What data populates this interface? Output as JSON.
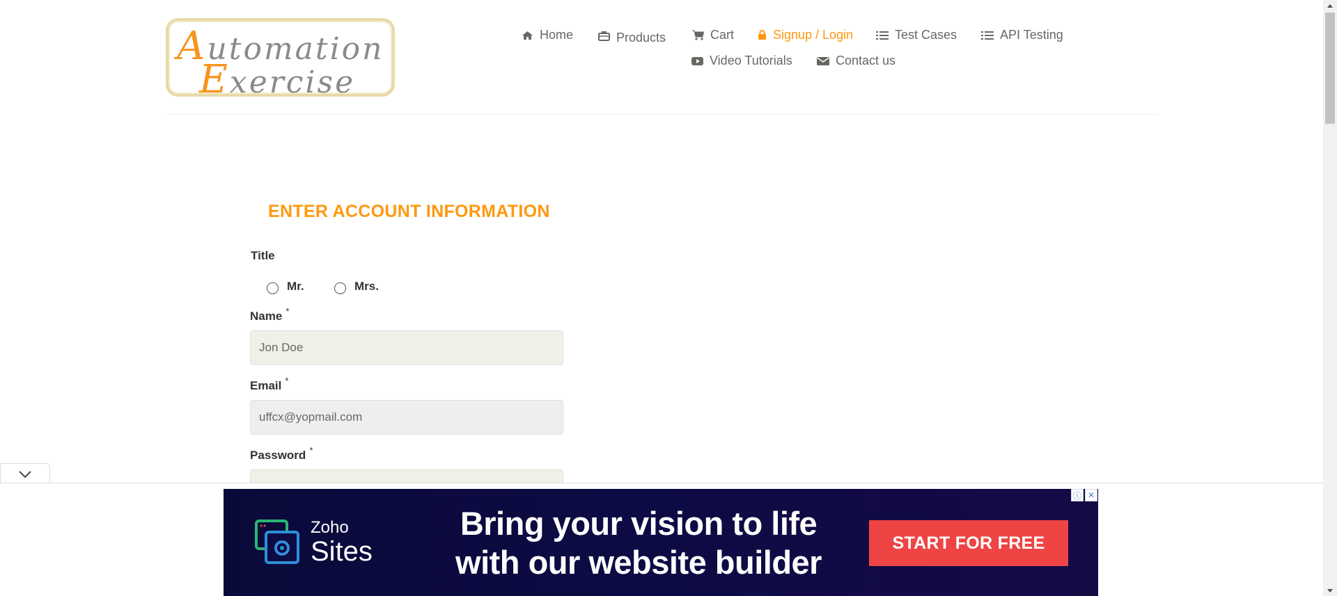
{
  "logo": {
    "line1_cap": "A",
    "line1_rest": "utomation",
    "line2_cap": "E",
    "line2_rest": "xercise"
  },
  "nav": {
    "items": [
      {
        "label": "Home",
        "icon": "home-icon"
      },
      {
        "label": "Products",
        "icon": "briefcase-icon"
      },
      {
        "label": "Cart",
        "icon": "cart-icon"
      },
      {
        "label": "Signup / Login",
        "icon": "lock-icon",
        "active": true
      },
      {
        "label": "Test Cases",
        "icon": "list-icon"
      },
      {
        "label": "API Testing",
        "icon": "list-icon"
      },
      {
        "label": "Video Tutorials",
        "icon": "youtube-play-icon"
      },
      {
        "label": "Contact us",
        "icon": "envelope-icon"
      }
    ]
  },
  "form": {
    "title": "ENTER ACCOUNT INFORMATION",
    "title_label": "Title",
    "radio_mr": "Mr.",
    "radio_mrs": "Mrs.",
    "name_label": "Name",
    "name_value": "Jon Doe",
    "email_label": "Email",
    "email_value": "uffcx@yopmail.com",
    "password_label": "Password",
    "required_mark": "*"
  },
  "ad": {
    "brand_small": "Zoho",
    "brand_big": "Sites",
    "headline_line1": "Bring your vision to life",
    "headline_line2": "with our website builder",
    "cta": "START FOR FREE",
    "info_glyph": "ⓘ",
    "close_glyph": "✕"
  },
  "colors": {
    "accent": "#fe980f",
    "nav_text": "#696763",
    "ad_bg": "#0d0b44",
    "ad_cta": "#ee4443"
  }
}
